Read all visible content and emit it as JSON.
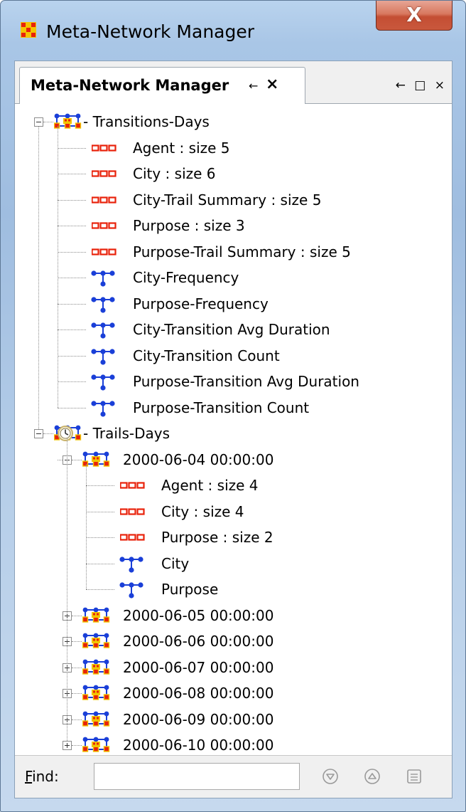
{
  "window": {
    "title": "Meta-Network Manager",
    "close_glyph": "X",
    "app_icon": "meta-network-icon"
  },
  "panel": {
    "tab_label": "Meta-Network Manager",
    "tab_pin_glyph": "←",
    "tab_close_glyph": "×",
    "strip_controls": [
      "←",
      "□",
      "×"
    ]
  },
  "tree": {
    "transitions": {
      "label": "- Transitions-Days",
      "icon": "meta-network-icon",
      "children": [
        {
          "label": "Agent : size 5",
          "icon": "nodeset-icon"
        },
        {
          "label": "City : size 6",
          "icon": "nodeset-icon"
        },
        {
          "label": "City-Trail Summary : size 5",
          "icon": "nodeset-icon"
        },
        {
          "label": "Purpose : size 3",
          "icon": "nodeset-icon"
        },
        {
          "label": "Purpose-Trail Summary : size 5",
          "icon": "nodeset-icon"
        },
        {
          "label": "City-Frequency",
          "icon": "network-icon"
        },
        {
          "label": "Purpose-Frequency",
          "icon": "network-icon"
        },
        {
          "label": "City-Transition Avg Duration",
          "icon": "network-icon"
        },
        {
          "label": "City-Transition Count",
          "icon": "network-icon"
        },
        {
          "label": "Purpose-Transition Avg Duration",
          "icon": "network-icon"
        },
        {
          "label": "Purpose-Transition Count",
          "icon": "network-icon"
        }
      ]
    },
    "trails": {
      "label": "- Trails-Days",
      "icon": "clock-meta-network-icon",
      "expanded_group": {
        "label": "2000-06-04 00:00:00",
        "icon": "meta-network-icon",
        "children": [
          {
            "label": "Agent : size 4",
            "icon": "nodeset-icon"
          },
          {
            "label": "City : size 4",
            "icon": "nodeset-icon"
          },
          {
            "label": "Purpose : size 2",
            "icon": "nodeset-icon"
          },
          {
            "label": "City",
            "icon": "network-icon"
          },
          {
            "label": "Purpose",
            "icon": "network-icon"
          }
        ]
      },
      "collapsed_groups": [
        {
          "label": "2000-06-05 00:00:00"
        },
        {
          "label": "2000-06-06 00:00:00"
        },
        {
          "label": "2000-06-07 00:00:00"
        },
        {
          "label": "2000-06-08 00:00:00"
        },
        {
          "label": "2000-06-09 00:00:00"
        },
        {
          "label": "2000-06-10 00:00:00"
        }
      ]
    }
  },
  "find": {
    "label": "Find:",
    "value": "",
    "placeholder": "",
    "buttons": [
      "find-next-icon",
      "find-previous-icon",
      "find-options-icon"
    ]
  },
  "colors": {
    "node_red": "#e8220b",
    "node_blue": "#1a3fd8",
    "node_yellow": "#f2c500",
    "close_red": "#c9583d"
  }
}
